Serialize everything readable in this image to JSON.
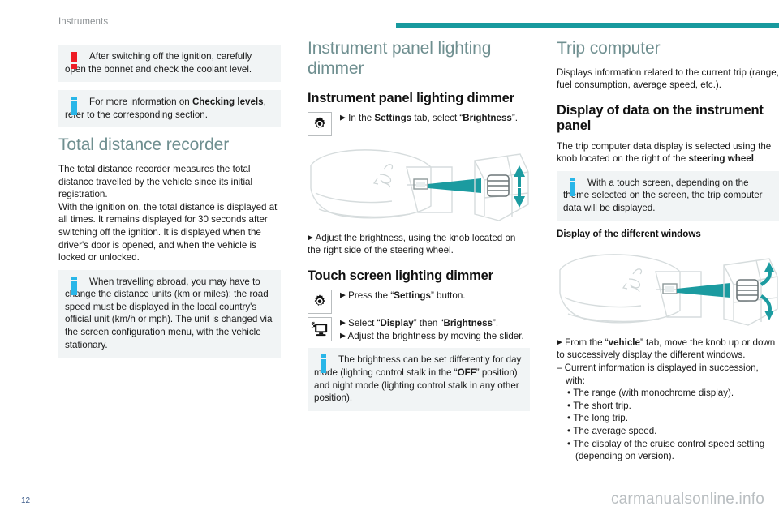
{
  "header": {
    "chapter": "Instruments",
    "rule_color": "#189a9e"
  },
  "colors": {
    "heading_teal": "#6f8f90",
    "rule_teal": "#189a9e",
    "warning_red": "#ee1c25",
    "info_blue": "#29b6e8",
    "callout_bg": "#f1f4f5",
    "page_number": "#3f5e8c",
    "watermark": "#b9bec1"
  },
  "column1": {
    "callout_warning": {
      "icon": "warning-exclamation-icon",
      "text": "After switching off the ignition, carefully open the bonnet and check the coolant level."
    },
    "callout_info_1": {
      "icon": "info-i-icon",
      "text_part1": "For more information on ",
      "text_bold": "Checking levels",
      "text_part2": ", refer to the corresponding section."
    },
    "heading": "Total distance recorder",
    "para1": "The total distance recorder measures the total distance travelled by the vehicle since its initial registration.",
    "para2": "With the ignition on, the total distance is displayed at all times. It remains displayed for 30 seconds after switching off the ignition. It is displayed when the driver's door is opened, and when the vehicle is locked or unlocked.",
    "callout_info_2": {
      "icon": "info-i-icon",
      "text": "When travelling abroad, you may have to change the distance units (km or miles): the road speed must be displayed in the local country's official unit (km/h or mph). The unit is changed via the screen configuration menu, with the vehicle stationary."
    }
  },
  "column2": {
    "heading": "Instrument panel lighting dimmer",
    "sub_heading_1": "Instrument panel lighting dimmer",
    "action_1": {
      "icon": "gear-settings-icon",
      "arrow": "▶",
      "text_part1": "In the ",
      "text_bold1": "Settings",
      "text_part2": " tab, select “",
      "text_bold2": "Brightness",
      "text_part3": "”."
    },
    "illustration": {
      "name": "steering-wheel-dimmer-knob-illustration",
      "brand_mark": "peugeot-lion-icon",
      "arrows": "up-down-arrows"
    },
    "action_2": {
      "arrow": "▶",
      "text": "Adjust the brightness, using the knob located on the right side of the steering wheel."
    },
    "sub_heading_2": "Touch screen lighting dimmer",
    "action_3": {
      "icon": "gear-settings-icon",
      "arrow": "▶",
      "text_part1": "Press the “",
      "text_bold": "Settings",
      "text_part2": "” button."
    },
    "action_4": {
      "icon": "display-brightness-icon",
      "arrow": "▶",
      "line1_part1": "Select “",
      "line1_bold1": "Display",
      "line1_part2": "” then “",
      "line1_bold2": "Brightness",
      "line1_part3": "”.",
      "line2": "Adjust the brightness by moving the slider."
    },
    "callout_info": {
      "icon": "info-i-icon",
      "text_part1": "The brightness can be set differently for day mode (lighting control stalk in the “",
      "text_bold1": "OFF",
      "text_part2": "” position) and night mode (lighting control stalk in any other position)."
    }
  },
  "column3": {
    "heading": "Trip computer",
    "para1": "Displays information related to the current trip (range, fuel consumption, average speed, etc.).",
    "sub_heading": "Display of data on the instrument panel",
    "para2_part1": "The trip computer data display is selected using the knob located on the right of the ",
    "para2_bold": "steering wheel",
    "para2_part2": ".",
    "callout_info": {
      "icon": "info-i-icon",
      "text": "With a touch screen, depending on the theme selected on the screen, the trip computer data will be displayed."
    },
    "sub_heading_2": "Display of the different windows",
    "illustration": {
      "name": "steering-wheel-dimmer-knob-illustration",
      "brand_mark": "peugeot-lion-icon",
      "arrows": "up-down-curved-arrows"
    },
    "action_1": {
      "arrow": "▶",
      "text_part1": "From the “",
      "text_bold": "vehicle",
      "text_part2": "” tab, move the knob up or down to successively display the different windows."
    },
    "dash_item": "– Current information is displayed in succession, with:",
    "bullets": [
      "The range (with monochrome display).",
      "The short trip.",
      "The long trip.",
      "The average speed.",
      "The display of the cruise control speed setting (depending on version)."
    ]
  },
  "footer": {
    "page_number": "12",
    "watermark": "carmanualsonline.info"
  }
}
